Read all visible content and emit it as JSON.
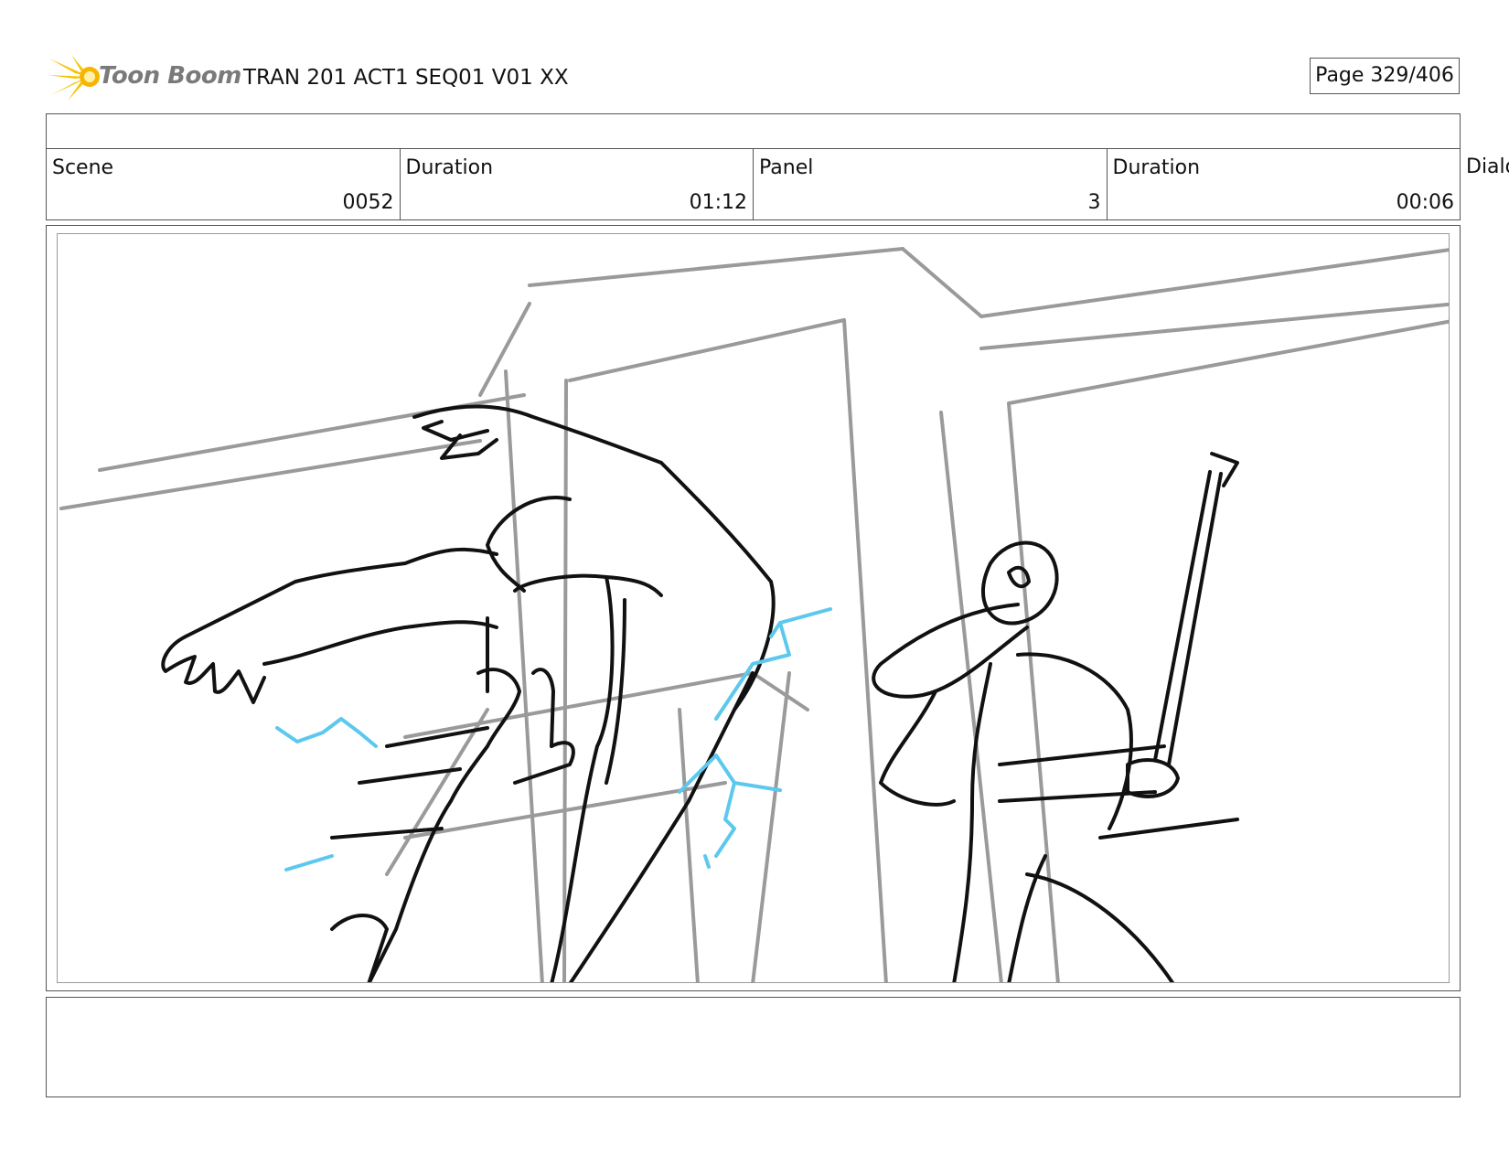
{
  "header": {
    "logo_text": "Toon Boom",
    "title": "TRAN 201 ACT1 SEQ01 V01 XX",
    "page": "Page 329/406"
  },
  "fields": [
    {
      "label": "Scene",
      "value": "0052"
    },
    {
      "label": "Duration",
      "value": "01:12"
    },
    {
      "label": "Panel",
      "value": "3"
    },
    {
      "label": "Duration",
      "value": "00:06"
    }
  ],
  "overflow_label": "Dialo",
  "colors": {
    "sketch_grey": "#9a9a9a",
    "sketch_ink": "#111111",
    "electric": "#5cc8ee",
    "logo_yellow": "#f5c400"
  }
}
